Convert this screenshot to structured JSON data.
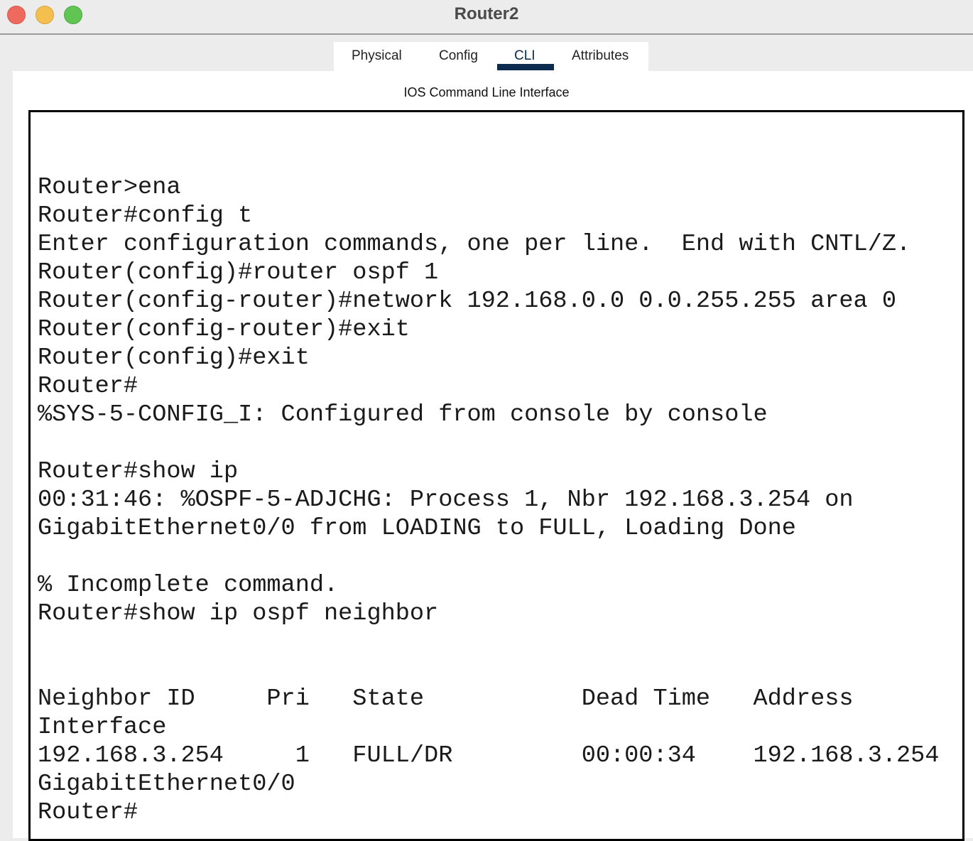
{
  "window": {
    "title": "Router2"
  },
  "traffic_lights": [
    {
      "name": "close",
      "color": "#ee6a5e"
    },
    {
      "name": "minimize",
      "color": "#f5bf4f"
    },
    {
      "name": "zoom",
      "color": "#61c554"
    }
  ],
  "tabs": [
    {
      "label": "Physical"
    },
    {
      "label": "Config"
    },
    {
      "label": "CLI",
      "active": true
    },
    {
      "label": "Attributes"
    }
  ],
  "panel": {
    "label": "IOS Command Line Interface"
  },
  "terminal": {
    "lines": [
      "",
      "",
      "Router>ena",
      "Router#config t",
      "Enter configuration commands, one per line.  End with CNTL/Z.",
      "Router(config)#router ospf 1",
      "Router(config-router)#network 192.168.0.0 0.0.255.255 area 0",
      "Router(config-router)#exit",
      "Router(config)#exit",
      "Router#",
      "%SYS-5-CONFIG_I: Configured from console by console",
      "",
      "Router#show ip",
      "00:31:46: %OSPF-5-ADJCHG: Process 1, Nbr 192.168.3.254 on",
      "GigabitEthernet0/0 from LOADING to FULL, Loading Done",
      "",
      "% Incomplete command.",
      "Router#show ip ospf neighbor",
      "",
      "",
      "Neighbor ID     Pri   State           Dead Time   Address",
      "Interface",
      "192.168.3.254     1   FULL/DR         00:00:34    192.168.3.254",
      "GigabitEthernet0/0",
      "Router#"
    ]
  }
}
